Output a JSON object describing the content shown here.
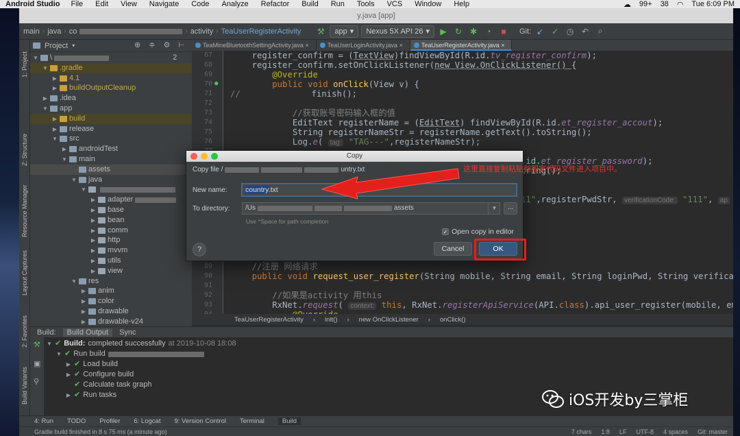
{
  "menubar": {
    "app": "Android Studio",
    "items": [
      "File",
      "Edit",
      "View",
      "Navigate",
      "Code",
      "Analyze",
      "Refactor",
      "Build",
      "Run",
      "Tools",
      "VCS",
      "Window",
      "Help"
    ],
    "right": [
      "99+",
      "38",
      "Tue 6:09 PM"
    ]
  },
  "window": {
    "title": "y.java [app]"
  },
  "nav": {
    "crumbs": [
      "main",
      "java",
      "co",
      "activity",
      "TeaUserRegisterActivity"
    ],
    "run_config": "app",
    "device": "Nexus 5X API 26",
    "git": "Git:"
  },
  "left_strip": [
    "1: Project",
    "Z: Structure",
    "Resource Manager",
    "Layout Captures",
    "2: Favorites",
    "Build Variants"
  ],
  "project": {
    "header": "Project",
    "tree": [
      {
        "label": "\\",
        "suffix": "2",
        "depth": 0,
        "arrow": "down",
        "kind": "folder"
      },
      {
        "label": ".gradle",
        "depth": 1,
        "arrow": "down",
        "kind": "ylw"
      },
      {
        "label": "4.1",
        "depth": 2,
        "arrow": "right",
        "kind": "ylw"
      },
      {
        "label": "buildOutputCleanup",
        "depth": 2,
        "arrow": "right",
        "kind": "ylw"
      },
      {
        "label": ".idea",
        "depth": 1,
        "arrow": "right",
        "kind": "folder"
      },
      {
        "label": "app",
        "depth": 1,
        "arrow": "down",
        "kind": "folder"
      },
      {
        "label": "build",
        "depth": 2,
        "arrow": "right",
        "kind": "ylw"
      },
      {
        "label": "release",
        "depth": 2,
        "arrow": "right",
        "kind": "folder"
      },
      {
        "label": "src",
        "depth": 2,
        "arrow": "down",
        "kind": "folder"
      },
      {
        "label": "androidTest",
        "depth": 3,
        "arrow": "right",
        "kind": "folder"
      },
      {
        "label": "main",
        "depth": 3,
        "arrow": "down",
        "kind": "folder"
      },
      {
        "label": "assets",
        "depth": 4,
        "arrow": "",
        "kind": "folder"
      },
      {
        "label": "java",
        "depth": 4,
        "arrow": "down",
        "kind": "folder"
      },
      {
        "label": "",
        "depth": 5,
        "arrow": "down",
        "kind": "pkg"
      },
      {
        "label": "adapter",
        "depth": 6,
        "arrow": "right",
        "kind": "pkg"
      },
      {
        "label": "base",
        "depth": 6,
        "arrow": "right",
        "kind": "pkg"
      },
      {
        "label": "bean",
        "depth": 6,
        "arrow": "right",
        "kind": "pkg"
      },
      {
        "label": "comm",
        "depth": 6,
        "arrow": "right",
        "kind": "pkg"
      },
      {
        "label": "http",
        "depth": 6,
        "arrow": "right",
        "kind": "pkg"
      },
      {
        "label": "mvvm",
        "depth": 6,
        "arrow": "right",
        "kind": "pkg"
      },
      {
        "label": "utils",
        "depth": 6,
        "arrow": "right",
        "kind": "pkg"
      },
      {
        "label": "view",
        "depth": 6,
        "arrow": "right",
        "kind": "pkg"
      },
      {
        "label": "res",
        "depth": 4,
        "arrow": "down",
        "kind": "folder"
      },
      {
        "label": "anim",
        "depth": 5,
        "arrow": "right",
        "kind": "folder"
      },
      {
        "label": "color",
        "depth": 5,
        "arrow": "right",
        "kind": "folder"
      },
      {
        "label": "drawable",
        "depth": 5,
        "arrow": "right",
        "kind": "folder"
      },
      {
        "label": "drawable-v24",
        "depth": 5,
        "arrow": "right",
        "kind": "folder"
      }
    ]
  },
  "editor": {
    "tabs": [
      "TeaMineBluetoothSettingActivity.java",
      "TeaUserLoginActivity.java",
      "TeaUserRegisterActivity.java"
    ],
    "line_numbers": [
      "67",
      "68",
      "69",
      "70",
      "71",
      "72",
      "73",
      "74",
      "75",
      "76",
      "77",
      "78",
      "79",
      "80",
      "81",
      "82",
      "83",
      "84",
      "85",
      "86",
      "87",
      "88",
      "89",
      "90",
      "91",
      "92",
      "93",
      "94"
    ],
    "breadcrumb": [
      "TeaUserRegisterActivity",
      "init()",
      "new OnClickListener",
      "onClick()"
    ]
  },
  "dialog": {
    "title": "Copy",
    "copy_file_label": "Copy file /",
    "copy_file_tail": "untry.txt",
    "new_name_label": "New name:",
    "new_name_selected": "country",
    "new_name_rest": ".txt",
    "to_dir_label": "To directory:",
    "dir_prefix": "/Us",
    "dir_tail": "assets",
    "browse": "...",
    "hint": "Use ^Space for path completion",
    "open_copy": "Open copy in editor",
    "help": "?",
    "cancel": "Cancel",
    "ok": "OK"
  },
  "annotation": {
    "text": "这里直接复制粘贴到国家代码文件进入项目中。"
  },
  "build": {
    "tabs": [
      "Build:",
      "Build Output",
      "Sync"
    ],
    "rows": [
      {
        "bold": "Build:",
        "text": "completed successfully",
        "time": "at 2019-10-08 18:08"
      },
      {
        "text": "Run build"
      },
      {
        "text": "Load build"
      },
      {
        "text": "Configure build"
      },
      {
        "text": "Calculate task graph"
      },
      {
        "text": "Run tasks"
      }
    ]
  },
  "tool_tabs": [
    "4: Run",
    "TODO",
    "Profiler",
    "6: Logcat",
    "9: Version Control",
    "Terminal",
    "Build"
  ],
  "status": {
    "message": "Gradle build finished in 8 s 75 ms (a minute ago)",
    "right": [
      "7 chars",
      "1:8",
      "LF",
      "UTF-8",
      "4 spaces",
      "Git: master"
    ]
  },
  "watermark": {
    "text": "iOS开发by三掌柜"
  },
  "colors": {
    "annotation_red": "#e3201b",
    "ok_blue": "#365880",
    "editor_bg": "#2b2b2b"
  }
}
